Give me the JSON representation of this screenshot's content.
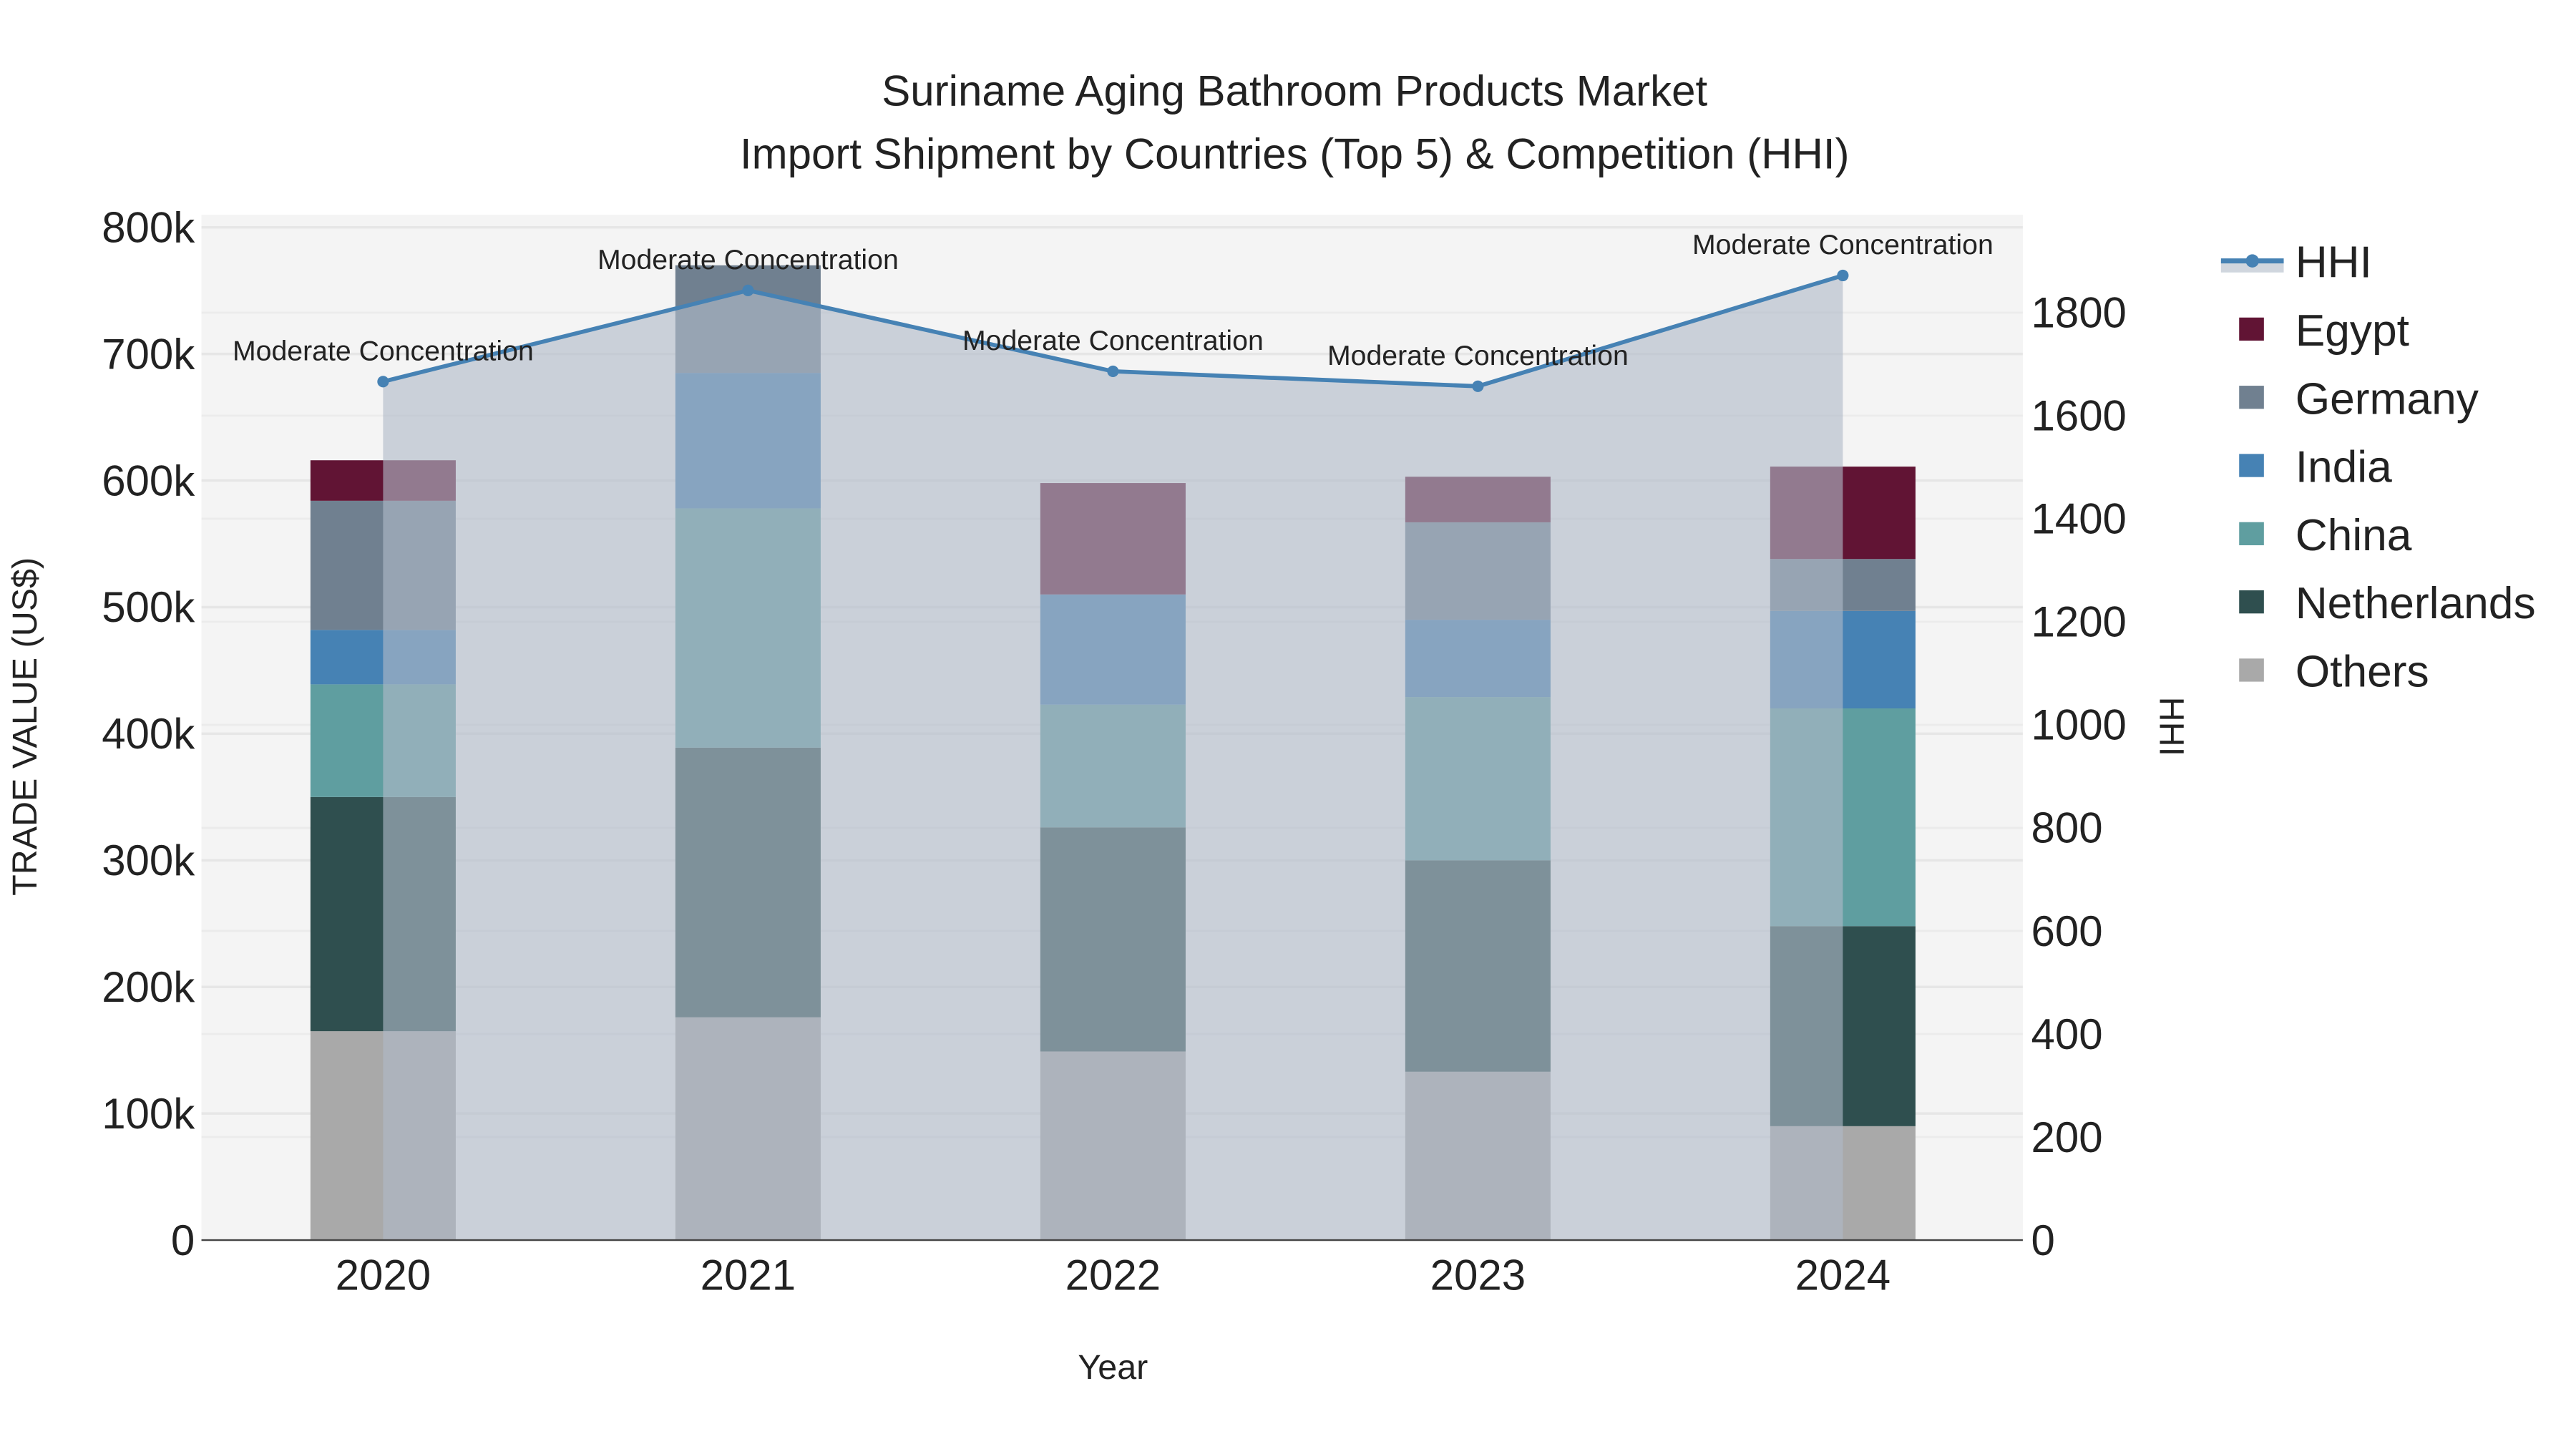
{
  "chart_data": {
    "type": "bar",
    "stacked": true,
    "title_line1": "Suriname Aging Bathroom Products Market",
    "title_line2": "Import Shipment by Countries (Top 5) & Competition (HHI)",
    "xlabel": "Year",
    "ylabel": "TRADE VALUE (US$)",
    "y2label": "HHI",
    "categories": [
      "2020",
      "2021",
      "2022",
      "2023",
      "2024"
    ],
    "ylim": [
      0,
      810000
    ],
    "y2lim": [
      0,
      1990
    ],
    "yticks": [
      0,
      100000,
      200000,
      300000,
      400000,
      500000,
      600000,
      700000,
      800000
    ],
    "ytick_labels": [
      "0",
      "100k",
      "200k",
      "300k",
      "400k",
      "500k",
      "600k",
      "700k",
      "800k"
    ],
    "y2ticks": [
      0,
      200,
      400,
      600,
      800,
      1000,
      1200,
      1400,
      1600,
      1800
    ],
    "y2tick_labels": [
      "0",
      "200",
      "400",
      "600",
      "800",
      "1000",
      "1200",
      "1400",
      "1600",
      "1800"
    ],
    "series": [
      {
        "name": "Others",
        "color": "#a9a9a9",
        "values": [
          165000,
          176000,
          149000,
          133000,
          90000
        ]
      },
      {
        "name": "Netherlands",
        "color": "#2f4f4f",
        "values": [
          185000,
          213000,
          177000,
          167000,
          158000
        ]
      },
      {
        "name": "China",
        "color": "#5f9ea0",
        "values": [
          89000,
          189000,
          97000,
          129000,
          172000
        ]
      },
      {
        "name": "India",
        "color": "#4682b4",
        "values": [
          43000,
          107000,
          87000,
          61000,
          77000
        ]
      },
      {
        "name": "Germany",
        "color": "#708090",
        "values": [
          102000,
          85000,
          0,
          77000,
          41000
        ]
      },
      {
        "name": "Egypt",
        "color": "#611434",
        "values": [
          32000,
          0,
          88000,
          36000,
          73000
        ]
      }
    ],
    "hhi": {
      "name": "HHI",
      "color": "#4682b4",
      "values": [
        1666,
        1843,
        1686,
        1657,
        1872
      ],
      "annotations": [
        "Moderate Concentration",
        "Moderate Concentration",
        "Moderate Concentration",
        "Moderate Concentration",
        "Moderate Concentration"
      ]
    },
    "legend": [
      "HHI",
      "Egypt",
      "Germany",
      "India",
      "China",
      "Netherlands",
      "Others"
    ],
    "legend_position": "right",
    "grid": true
  }
}
